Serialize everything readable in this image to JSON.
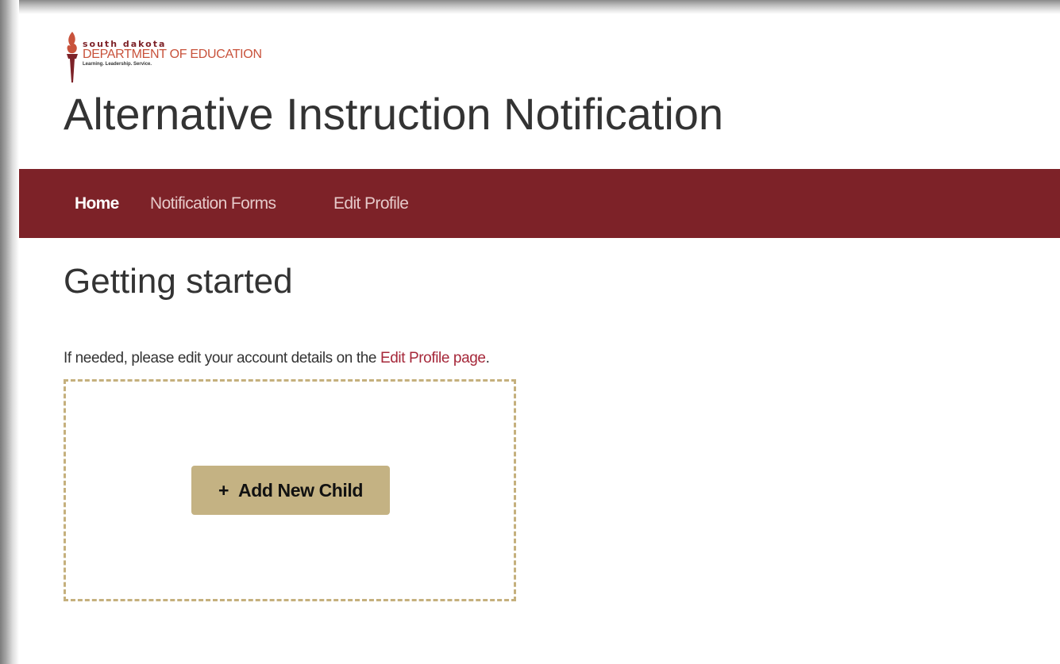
{
  "logo": {
    "line1": "south dakota",
    "line2": "DEPARTMENT OF EDUCATION",
    "line3": "Learning. Leadership. Service."
  },
  "header": {
    "title": "Alternative Instruction Notification"
  },
  "nav": {
    "items": [
      {
        "label": "Home",
        "active": true
      },
      {
        "label": "Notification Forms",
        "active": false
      },
      {
        "label": "Edit Profile",
        "active": false
      }
    ]
  },
  "main": {
    "title": "Getting started",
    "intro_before": "If needed, please edit your account details on the ",
    "intro_link": "Edit Profile page",
    "intro_after": ".",
    "add_child": {
      "icon": "plus-icon",
      "icon_glyph": "+",
      "label": "Add New Child"
    }
  },
  "colors": {
    "brand_maroon": "#7d2228",
    "link": "#a6283a",
    "gold": "#c4b283",
    "gold_border": "#c5b07d",
    "text": "#333333"
  }
}
